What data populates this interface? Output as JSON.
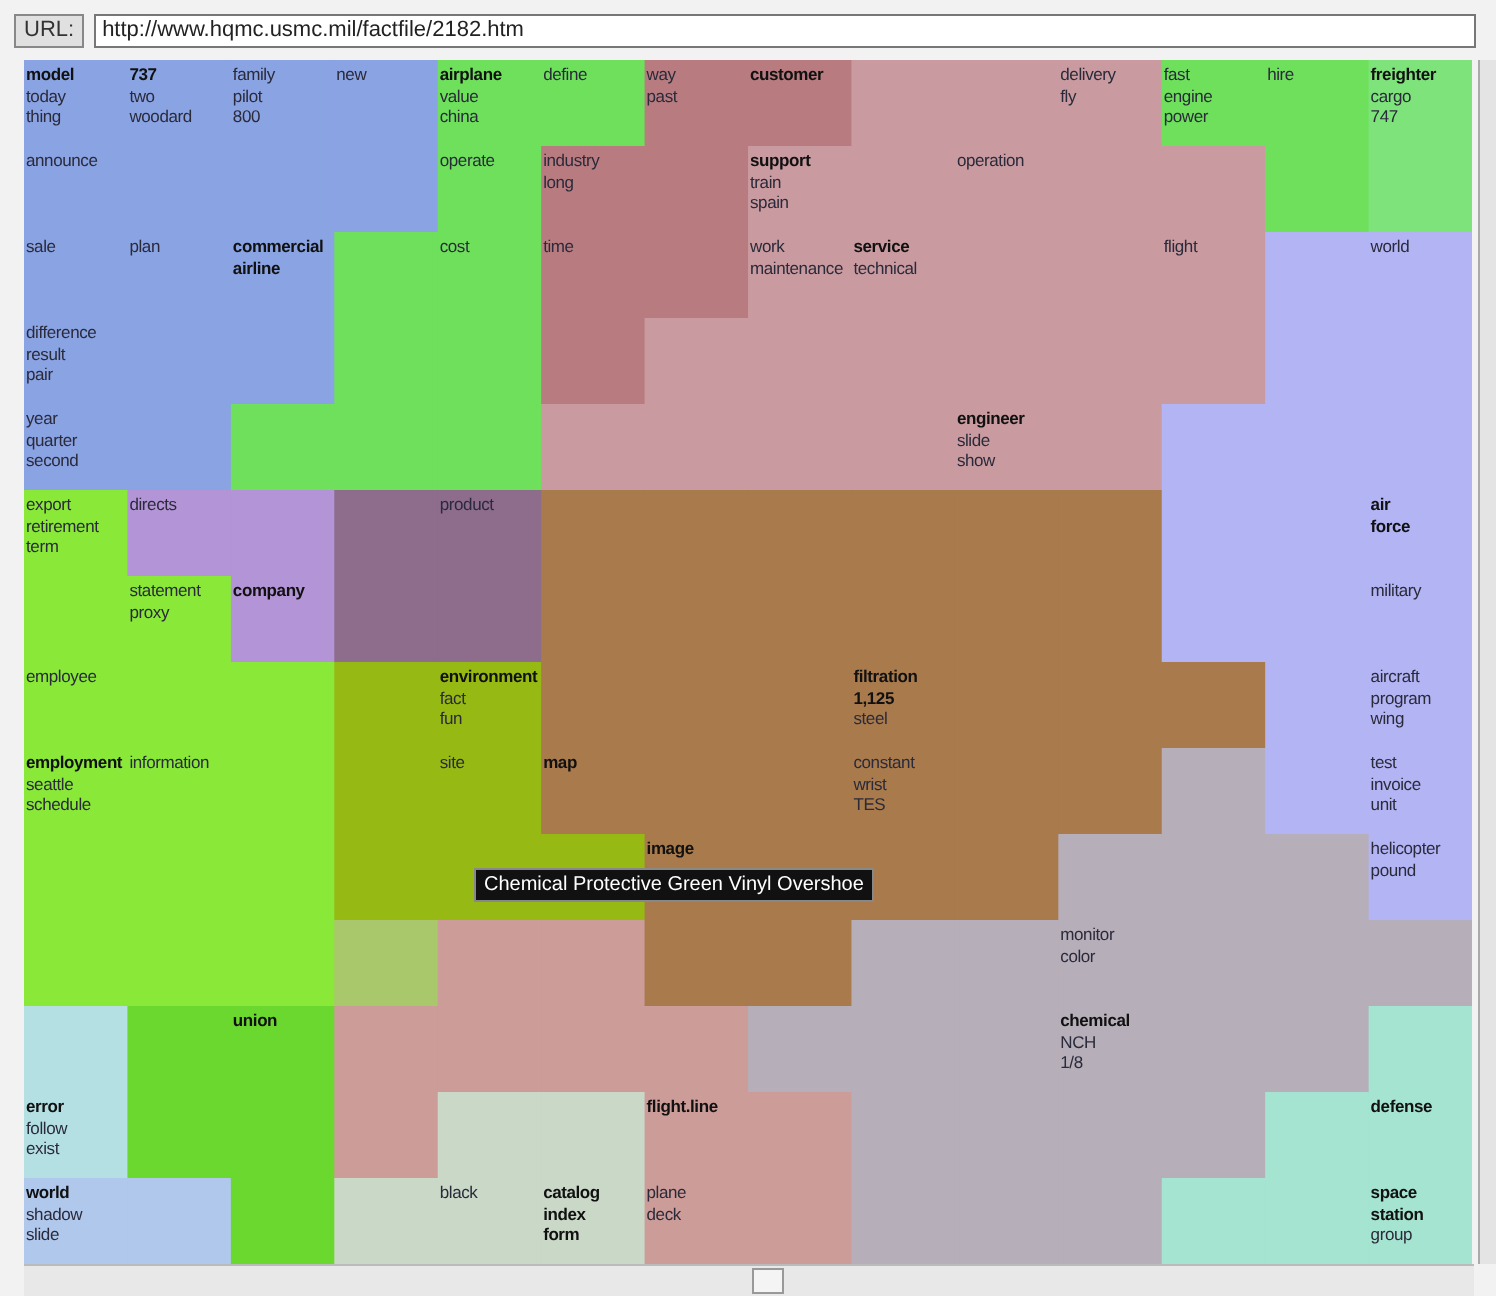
{
  "toolbar": {
    "url_label": "URL:",
    "url": "http://www.hqmc.usmc.mil/factfile/2182.htm"
  },
  "map": {
    "rows": [
      {
        "cells": [
          {
            "color": "#8aa3e3",
            "words": [
              {
                "text": "model",
                "bold": true
              },
              {
                "text": "today",
                "bold": false
              },
              {
                "text": "thing",
                "bold": false
              }
            ]
          },
          {
            "color": "#8aa3e3",
            "words": [
              {
                "text": "737",
                "bold": true
              },
              {
                "text": "two",
                "bold": false
              },
              {
                "text": "woodard",
                "bold": false
              }
            ]
          },
          {
            "color": "#8aa3e3",
            "words": [
              {
                "text": "family",
                "bold": false
              },
              {
                "text": "pilot",
                "bold": false
              },
              {
                "text": "800",
                "bold": false
              }
            ]
          },
          {
            "color": "#8aa3e3",
            "words": [
              {
                "text": "new",
                "bold": false
              }
            ]
          },
          {
            "color": "#6ee05c",
            "words": [
              {
                "text": "airplane",
                "bold": true
              },
              {
                "text": "value",
                "bold": false
              },
              {
                "text": "china",
                "bold": false
              }
            ]
          },
          {
            "color": "#6ee05c",
            "words": [
              {
                "text": "define",
                "bold": false
              }
            ]
          },
          {
            "color": "#b87c80",
            "words": [
              {
                "text": "way",
                "bold": false
              },
              {
                "text": "past",
                "bold": false
              }
            ]
          },
          {
            "color": "#b87c80",
            "words": [
              {
                "text": "customer",
                "bold": true
              }
            ]
          },
          {
            "color": "#c99ba0"
          },
          {
            "color": "#c99ba0"
          },
          {
            "color": "#c99ba0",
            "words": [
              {
                "text": "delivery",
                "bold": false
              },
              {
                "text": "fly",
                "bold": false
              }
            ]
          },
          {
            "color": "#6ee05c",
            "words": [
              {
                "text": "fast",
                "bold": false
              },
              {
                "text": "engine",
                "bold": false
              },
              {
                "text": "power",
                "bold": false
              }
            ]
          },
          {
            "color": "#6ee05c",
            "words": [
              {
                "text": "hire",
                "bold": false
              }
            ]
          },
          {
            "color": "#7ee37a",
            "words": [
              {
                "text": "freighter",
                "bold": true
              },
              {
                "text": "cargo",
                "bold": false
              },
              {
                "text": "747",
                "bold": false
              }
            ]
          }
        ]
      },
      {
        "cells": [
          {
            "color": "#8aa3e3",
            "words": [
              {
                "text": "announce",
                "bold": false
              }
            ]
          },
          {
            "color": "#8aa3e3"
          },
          {
            "color": "#8aa3e3"
          },
          {
            "color": "#8aa3e3"
          },
          {
            "color": "#6ee05c",
            "words": [
              {
                "text": "operate",
                "bold": false
              }
            ]
          },
          {
            "color": "#b87c80",
            "words": [
              {
                "text": "industry",
                "bold": false
              },
              {
                "text": "long",
                "bold": false
              }
            ]
          },
          {
            "color": "#b87c80"
          },
          {
            "color": "#c99ba0",
            "words": [
              {
                "text": "support",
                "bold": true
              },
              {
                "text": "train",
                "bold": false
              },
              {
                "text": "spain",
                "bold": false
              }
            ]
          },
          {
            "color": "#c99ba0"
          },
          {
            "color": "#c99ba0",
            "words": [
              {
                "text": "operation",
                "bold": false
              }
            ]
          },
          {
            "color": "#c99ba0"
          },
          {
            "color": "#c99ba0"
          },
          {
            "color": "#6ee05c"
          },
          {
            "color": "#7ee37a"
          }
        ]
      },
      {
        "cells": [
          {
            "color": "#8aa3e3",
            "words": [
              {
                "text": "sale",
                "bold": false
              }
            ]
          },
          {
            "color": "#8aa3e3",
            "words": [
              {
                "text": "plan",
                "bold": false
              }
            ]
          },
          {
            "color": "#8aa3e3",
            "words": [
              {
                "text": "commercial",
                "bold": true
              },
              {
                "text": "airline",
                "bold": true
              }
            ]
          },
          {
            "color": "#6ee05c"
          },
          {
            "color": "#6ee05c",
            "words": [
              {
                "text": "cost",
                "bold": false
              }
            ]
          },
          {
            "color": "#b87c80",
            "words": [
              {
                "text": "time",
                "bold": false
              }
            ]
          },
          {
            "color": "#b87c80"
          },
          {
            "color": "#c99ba0",
            "words": [
              {
                "text": "work",
                "bold": false
              },
              {
                "text": "maintenance",
                "bold": false
              }
            ]
          },
          {
            "color": "#c99ba0",
            "words": [
              {
                "text": "service",
                "bold": true
              },
              {
                "text": "technical",
                "bold": false
              }
            ]
          },
          {
            "color": "#c99ba0"
          },
          {
            "color": "#c99ba0"
          },
          {
            "color": "#c99ba0",
            "words": [
              {
                "text": "flight",
                "bold": false
              }
            ]
          },
          {
            "color": "#b3b4f4"
          },
          {
            "color": "#b3b4f4",
            "words": [
              {
                "text": "world",
                "bold": false
              }
            ]
          }
        ]
      },
      {
        "cells": [
          {
            "color": "#8aa3e3",
            "words": [
              {
                "text": "difference",
                "bold": false
              },
              {
                "text": "result",
                "bold": false
              },
              {
                "text": "pair",
                "bold": false
              }
            ]
          },
          {
            "color": "#8aa3e3"
          },
          {
            "color": "#8aa3e3"
          },
          {
            "color": "#6ee05c"
          },
          {
            "color": "#6ee05c"
          },
          {
            "color": "#b87c80"
          },
          {
            "color": "#c99ba0"
          },
          {
            "color": "#c99ba0"
          },
          {
            "color": "#c99ba0"
          },
          {
            "color": "#c99ba0"
          },
          {
            "color": "#c99ba0"
          },
          {
            "color": "#c99ba0"
          },
          {
            "color": "#b3b4f4"
          },
          {
            "color": "#b3b4f4"
          }
        ]
      },
      {
        "cells": [
          {
            "color": "#8aa3e3",
            "words": [
              {
                "text": "year",
                "bold": false
              },
              {
                "text": "quarter",
                "bold": false
              },
              {
                "text": "second",
                "bold": false
              }
            ]
          },
          {
            "color": "#8aa3e3"
          },
          {
            "color": "#6ee05c"
          },
          {
            "color": "#6ee05c"
          },
          {
            "color": "#6ee05c"
          },
          {
            "color": "#c99ba0"
          },
          {
            "color": "#c99ba0"
          },
          {
            "color": "#c99ba0"
          },
          {
            "color": "#c99ba0"
          },
          {
            "color": "#c99ba0",
            "words": [
              {
                "text": "engineer",
                "bold": true
              },
              {
                "text": "slide",
                "bold": false
              },
              {
                "text": "show",
                "bold": false
              }
            ]
          },
          {
            "color": "#c99ba0"
          },
          {
            "color": "#b3b4f4"
          },
          {
            "color": "#b3b4f4"
          },
          {
            "color": "#b3b4f4"
          }
        ]
      },
      {
        "cells": [
          {
            "color": "#8ae838",
            "words": [
              {
                "text": "export",
                "bold": false
              },
              {
                "text": "retirement",
                "bold": false
              },
              {
                "text": "term",
                "bold": false
              }
            ]
          },
          {
            "color": "#b394d6",
            "words": [
              {
                "text": "directs",
                "bold": false
              }
            ]
          },
          {
            "color": "#b394d6"
          },
          {
            "color": "#8d6c8c"
          },
          {
            "color": "#8d6c8c",
            "words": [
              {
                "text": "product",
                "bold": false
              }
            ]
          },
          {
            "color": "#a87a4c"
          },
          {
            "color": "#a87a4c"
          },
          {
            "color": "#a87a4c"
          },
          {
            "color": "#a87a4c"
          },
          {
            "color": "#a87a4c"
          },
          {
            "color": "#a87a4c"
          },
          {
            "color": "#b3b4f4"
          },
          {
            "color": "#b3b4f4"
          },
          {
            "color": "#b3b4f4",
            "words": [
              {
                "text": "air",
                "bold": true
              },
              {
                "text": "force",
                "bold": true
              }
            ]
          }
        ]
      },
      {
        "cells": [
          {
            "color": "#8ae838"
          },
          {
            "color": "#8ae838",
            "words": [
              {
                "text": "statement",
                "bold": false
              },
              {
                "text": "proxy",
                "bold": false
              }
            ]
          },
          {
            "color": "#b394d6",
            "words": [
              {
                "text": "company",
                "bold": true
              }
            ]
          },
          {
            "color": "#8d6c8c"
          },
          {
            "color": "#8d6c8c"
          },
          {
            "color": "#a87a4c"
          },
          {
            "color": "#a87a4c"
          },
          {
            "color": "#a87a4c"
          },
          {
            "color": "#a87a4c"
          },
          {
            "color": "#a87a4c"
          },
          {
            "color": "#a87a4c"
          },
          {
            "color": "#b3b4f4"
          },
          {
            "color": "#b3b4f4"
          },
          {
            "color": "#b3b4f4",
            "words": [
              {
                "text": "military",
                "bold": false
              }
            ]
          }
        ]
      },
      {
        "cells": [
          {
            "color": "#8ae838",
            "words": [
              {
                "text": "employee",
                "bold": false
              }
            ]
          },
          {
            "color": "#8ae838"
          },
          {
            "color": "#8ae838"
          },
          {
            "color": "#97b914"
          },
          {
            "color": "#97b914",
            "words": [
              {
                "text": "environment",
                "bold": true
              },
              {
                "text": "fact",
                "bold": false
              },
              {
                "text": "fun",
                "bold": false
              }
            ]
          },
          {
            "color": "#a87a4c"
          },
          {
            "color": "#a87a4c"
          },
          {
            "color": "#a87a4c"
          },
          {
            "color": "#a87a4c",
            "words": [
              {
                "text": "filtration",
                "bold": true
              },
              {
                "text": "1,125",
                "bold": true
              },
              {
                "text": "steel",
                "bold": false
              }
            ]
          },
          {
            "color": "#a87a4c"
          },
          {
            "color": "#a87a4c"
          },
          {
            "color": "#a87a4c"
          },
          {
            "color": "#b3b4f4"
          },
          {
            "color": "#b3b4f4",
            "words": [
              {
                "text": "aircraft",
                "bold": false
              },
              {
                "text": "program",
                "bold": false
              },
              {
                "text": "wing",
                "bold": false
              }
            ]
          }
        ]
      },
      {
        "cells": [
          {
            "color": "#8ae838",
            "words": [
              {
                "text": "employment",
                "bold": true
              },
              {
                "text": "seattle",
                "bold": false
              },
              {
                "text": "schedule",
                "bold": false
              }
            ]
          },
          {
            "color": "#8ae838",
            "words": [
              {
                "text": "information",
                "bold": false
              }
            ]
          },
          {
            "color": "#8ae838"
          },
          {
            "color": "#97b914"
          },
          {
            "color": "#97b914",
            "words": [
              {
                "text": "site",
                "bold": false
              }
            ]
          },
          {
            "color": "#a87a4c",
            "words": [
              {
                "text": "map",
                "bold": true
              }
            ]
          },
          {
            "color": "#a87a4c"
          },
          {
            "color": "#a87a4c"
          },
          {
            "color": "#a87a4c",
            "words": [
              {
                "text": "constant",
                "bold": false
              },
              {
                "text": "wrist",
                "bold": false
              },
              {
                "text": "TES",
                "bold": false
              }
            ]
          },
          {
            "color": "#a87a4c"
          },
          {
            "color": "#a87a4c"
          },
          {
            "color": "#b6aeb8"
          },
          {
            "color": "#b3b4f4"
          },
          {
            "color": "#b3b4f4",
            "words": [
              {
                "text": "test",
                "bold": false
              },
              {
                "text": "invoice",
                "bold": false
              },
              {
                "text": "unit",
                "bold": false
              }
            ]
          }
        ]
      },
      {
        "cells": [
          {
            "color": "#8ae838"
          },
          {
            "color": "#8ae838"
          },
          {
            "color": "#8ae838"
          },
          {
            "color": "#97b914"
          },
          {
            "color": "#97b914"
          },
          {
            "color": "#97b914"
          },
          {
            "color": "#a87a4c",
            "words": [
              {
                "text": "image",
                "bold": true
              }
            ]
          },
          {
            "color": "#a87a4c"
          },
          {
            "color": "#a87a4c"
          },
          {
            "color": "#a87a4c"
          },
          {
            "color": "#b6aeb8"
          },
          {
            "color": "#b6aeb8"
          },
          {
            "color": "#b6aeb8"
          },
          {
            "color": "#b3b4f4",
            "words": [
              {
                "text": "helicopter",
                "bold": false
              },
              {
                "text": "pound",
                "bold": false
              }
            ]
          }
        ]
      },
      {
        "cells": [
          {
            "color": "#8ae838"
          },
          {
            "color": "#8ae838"
          },
          {
            "color": "#8ae838"
          },
          {
            "color": "#a9c86c"
          },
          {
            "color": "#cc9c98"
          },
          {
            "color": "#cc9c98"
          },
          {
            "color": "#a87a4c"
          },
          {
            "color": "#a87a4c"
          },
          {
            "color": "#b6aeb8"
          },
          {
            "color": "#b6aeb8"
          },
          {
            "color": "#b6aeb8",
            "words": [
              {
                "text": "monitor",
                "bold": false
              },
              {
                "text": "color",
                "bold": false
              }
            ]
          },
          {
            "color": "#b6aeb8"
          },
          {
            "color": "#b6aeb8"
          },
          {
            "color": "#b6aeb8"
          }
        ]
      },
      {
        "cells": [
          {
            "color": "#b4e0e4"
          },
          {
            "color": "#6ad82e"
          },
          {
            "color": "#6ad82e",
            "words": [
              {
                "text": "union",
                "bold": true
              }
            ]
          },
          {
            "color": "#cc9c98"
          },
          {
            "color": "#cc9c98"
          },
          {
            "color": "#cc9c98"
          },
          {
            "color": "#cc9c98"
          },
          {
            "color": "#b6aeb8"
          },
          {
            "color": "#b6aeb8"
          },
          {
            "color": "#b6aeb8"
          },
          {
            "color": "#b6aeb8",
            "words": [
              {
                "text": "chemical",
                "bold": true
              },
              {
                "text": "NCH",
                "bold": false
              },
              {
                "text": "1/8",
                "bold": false
              }
            ]
          },
          {
            "color": "#b6aeb8"
          },
          {
            "color": "#b6aeb8"
          },
          {
            "color": "#a4e4d0"
          }
        ]
      },
      {
        "cells": [
          {
            "color": "#b4e0e4",
            "words": [
              {
                "text": "error",
                "bold": true
              },
              {
                "text": "follow",
                "bold": false
              },
              {
                "text": "exist",
                "bold": false
              }
            ]
          },
          {
            "color": "#6ad82e"
          },
          {
            "color": "#6ad82e"
          },
          {
            "color": "#cc9c98"
          },
          {
            "color": "#cad8c8"
          },
          {
            "color": "#cad8c8"
          },
          {
            "color": "#cc9c98",
            "words": [
              {
                "text": "flight.line",
                "bold": true
              }
            ]
          },
          {
            "color": "#cc9c98"
          },
          {
            "color": "#b6aeb8"
          },
          {
            "color": "#b6aeb8"
          },
          {
            "color": "#b6aeb8"
          },
          {
            "color": "#b6aeb8"
          },
          {
            "color": "#a4e4d0"
          },
          {
            "color": "#a4e4d0",
            "words": [
              {
                "text": "defense",
                "bold": true
              }
            ]
          }
        ]
      },
      {
        "cells": [
          {
            "color": "#b0c8ec",
            "words": [
              {
                "text": "world",
                "bold": true
              },
              {
                "text": "shadow",
                "bold": false
              },
              {
                "text": "slide",
                "bold": false
              }
            ]
          },
          {
            "color": "#b0c8ec"
          },
          {
            "color": "#6ad82e"
          },
          {
            "color": "#cad8c8"
          },
          {
            "color": "#cad8c8",
            "words": [
              {
                "text": "black",
                "bold": false
              }
            ]
          },
          {
            "color": "#cad8c8",
            "words": [
              {
                "text": "catalog",
                "bold": true
              },
              {
                "text": "index",
                "bold": true
              },
              {
                "text": "form",
                "bold": true
              }
            ]
          },
          {
            "color": "#cc9c98",
            "words": [
              {
                "text": "plane",
                "bold": false
              },
              {
                "text": "deck",
                "bold": false
              }
            ]
          },
          {
            "color": "#cc9c98"
          },
          {
            "color": "#b6aeb8"
          },
          {
            "color": "#b6aeb8"
          },
          {
            "color": "#b6aeb8"
          },
          {
            "color": "#a4e4d0"
          },
          {
            "color": "#a4e4d0"
          },
          {
            "color": "#a4e4d0",
            "words": [
              {
                "text": "space",
                "bold": true
              },
              {
                "text": "station",
                "bold": true
              },
              {
                "text": "group",
                "bold": false
              }
            ]
          }
        ]
      }
    ],
    "tooltip": "Chemical Protective Green Vinyl Overshoe"
  }
}
